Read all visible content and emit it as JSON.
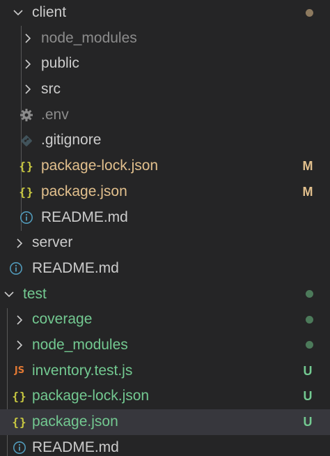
{
  "colors": {
    "background": "#252526",
    "selected_row": "#37373d",
    "default_text": "#cccccc",
    "ignored_text": "#8c8c8c",
    "modified": "#e2c08d",
    "untracked": "#73c991",
    "folder_dot_client": "#8d7a5f",
    "folder_dot_test": "#4c7a5a"
  },
  "tree": {
    "client": {
      "label": "client",
      "expanded": true
    },
    "client_node_modules": {
      "label": "node_modules"
    },
    "client_public": {
      "label": "public"
    },
    "client_src": {
      "label": "src"
    },
    "client_env": {
      "label": ".env",
      "icon": "gear-icon"
    },
    "client_gitignore": {
      "label": ".gitignore",
      "icon": "git-icon"
    },
    "client_package_lock": {
      "label": "package-lock.json",
      "icon": "json-braces-icon",
      "icon_text": "{}",
      "badge": "M"
    },
    "client_package": {
      "label": "package.json",
      "icon": "json-braces-icon",
      "icon_text": "{}",
      "badge": "M"
    },
    "client_readme": {
      "label": "README.md",
      "icon": "info-icon"
    },
    "server": {
      "label": "server",
      "expanded": false
    },
    "root_readme": {
      "label": "README.md",
      "icon": "info-icon"
    },
    "test": {
      "label": "test",
      "expanded": true
    },
    "test_coverage": {
      "label": "coverage"
    },
    "test_node_modules": {
      "label": "node_modules"
    },
    "test_inventory": {
      "label": "inventory.test.js",
      "icon": "javascript-file-icon",
      "icon_text": "JS",
      "badge": "U"
    },
    "test_package_lock": {
      "label": "package-lock.json",
      "icon": "json-braces-icon",
      "icon_text": "{}",
      "badge": "U"
    },
    "test_package": {
      "label": "package.json",
      "icon": "json-braces-icon",
      "icon_text": "{}",
      "badge": "U",
      "selected": true
    },
    "test_readme": {
      "label": "README.md",
      "icon": "info-icon"
    }
  }
}
